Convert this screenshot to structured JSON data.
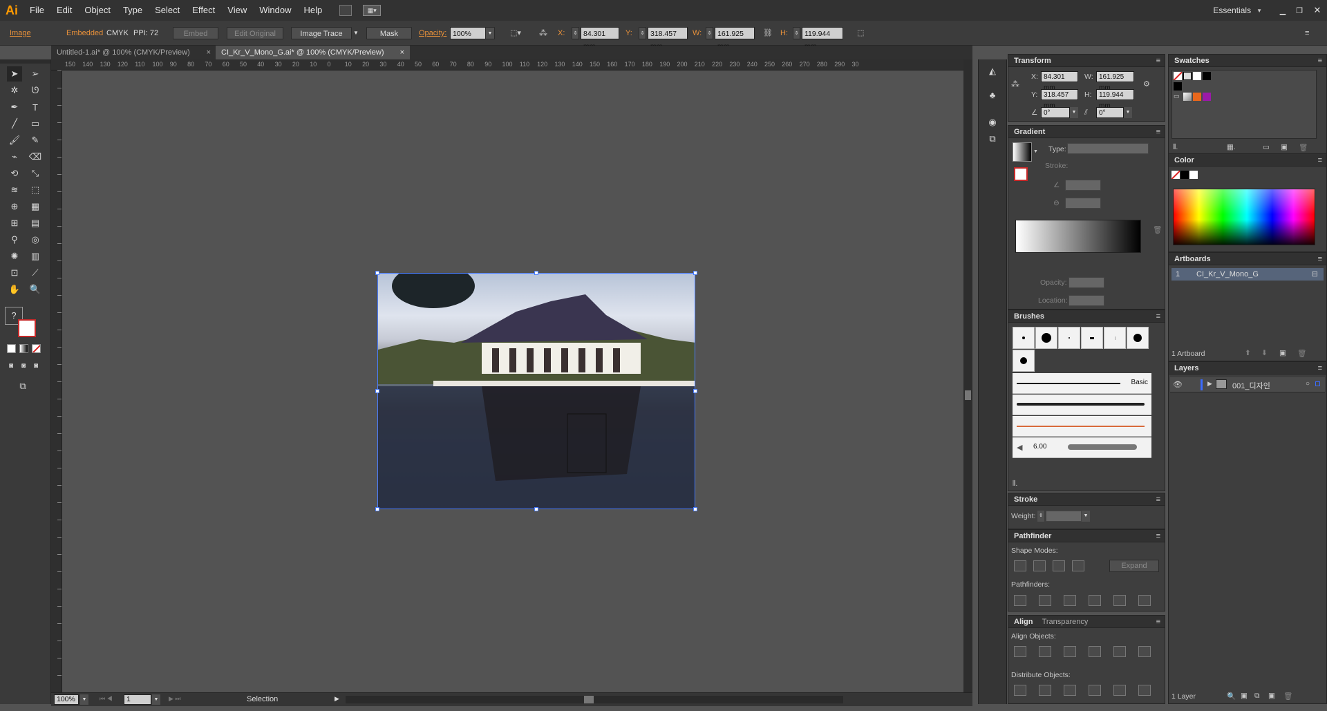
{
  "app": {
    "logo": "Ai"
  },
  "menubar": {
    "items": [
      "File",
      "Edit",
      "Object",
      "Type",
      "Select",
      "Effect",
      "View",
      "Window",
      "Help"
    ],
    "workspace": "Essentials"
  },
  "control": {
    "type_label": "Image",
    "embedded": "Embedded",
    "color_mode": "CMYK",
    "ppi": "PPI: 72",
    "embed_btn": "Embed",
    "edit_original_btn": "Edit Original",
    "image_trace_btn": "Image Trace",
    "mask_btn": "Mask",
    "opacity_label": "Opacity:",
    "opacity_value": "100%",
    "x_label": "X:",
    "x_value": "84.301 mm",
    "y_label": "Y:",
    "y_value": "318.457 mm",
    "w_label": "W:",
    "w_value": "161.925 mm",
    "h_label": "H:",
    "h_value": "119.944 mm"
  },
  "tabs": [
    {
      "label": "Untitled-1.ai* @ 100% (CMYK/Preview)"
    },
    {
      "label": "CI_Kr_V_Mono_G.ai* @ 100% (CMYK/Preview)"
    }
  ],
  "ruler": {
    "h_ticks": [
      "150",
      "140",
      "130",
      "120",
      "110",
      "100",
      "90",
      "80",
      "70",
      "60",
      "50",
      "40",
      "30",
      "20",
      "10",
      "0",
      "10",
      "20",
      "30",
      "40",
      "50",
      "60",
      "70",
      "80",
      "90",
      "100",
      "110",
      "120",
      "130",
      "140",
      "150",
      "160",
      "170",
      "180",
      "190",
      "200",
      "210",
      "220",
      "230",
      "240",
      "250",
      "260",
      "270",
      "280",
      "290",
      "30"
    ]
  },
  "status": {
    "zoom": "100%",
    "page": "1",
    "tool": "Selection"
  },
  "transform": {
    "title": "Transform",
    "x_label": "X:",
    "x": "84.301 mm",
    "y_label": "Y:",
    "y": "318.457 mm",
    "w_label": "W:",
    "w": "161.925 mm",
    "h_label": "H:",
    "h": "119.944 mm",
    "rotate": "0°",
    "shear": "0°"
  },
  "gradient": {
    "title": "Gradient",
    "type_label": "Type:",
    "stroke_label": "Stroke:",
    "opacity_label": "Opacity:",
    "location_label": "Location:"
  },
  "brushes": {
    "title": "Brushes",
    "basic_label": "Basic",
    "size_label": "6.00"
  },
  "stroke": {
    "title": "Stroke",
    "weight_label": "Weight:"
  },
  "pathfinder": {
    "title": "Pathfinder",
    "shape_modes": "Shape Modes:",
    "pathfinders": "Pathfinders:",
    "expand_btn": "Expand"
  },
  "align": {
    "title": "Align",
    "tab2": "Transparency",
    "align_objects": "Align Objects:",
    "distribute_objects": "Distribute Objects:"
  },
  "swatches": {
    "title": "Swatches"
  },
  "color": {
    "title": "Color"
  },
  "artboards": {
    "title": "Artboards",
    "row_num": "1",
    "row_name": "CI_Kr_V_Mono_G",
    "count": "1 Artboard"
  },
  "layers": {
    "title": "Layers",
    "row_name": "001_디자인",
    "count": "1 Layer"
  },
  "colors": {
    "accent": "#e8913a",
    "selection": "#4a7dff"
  }
}
